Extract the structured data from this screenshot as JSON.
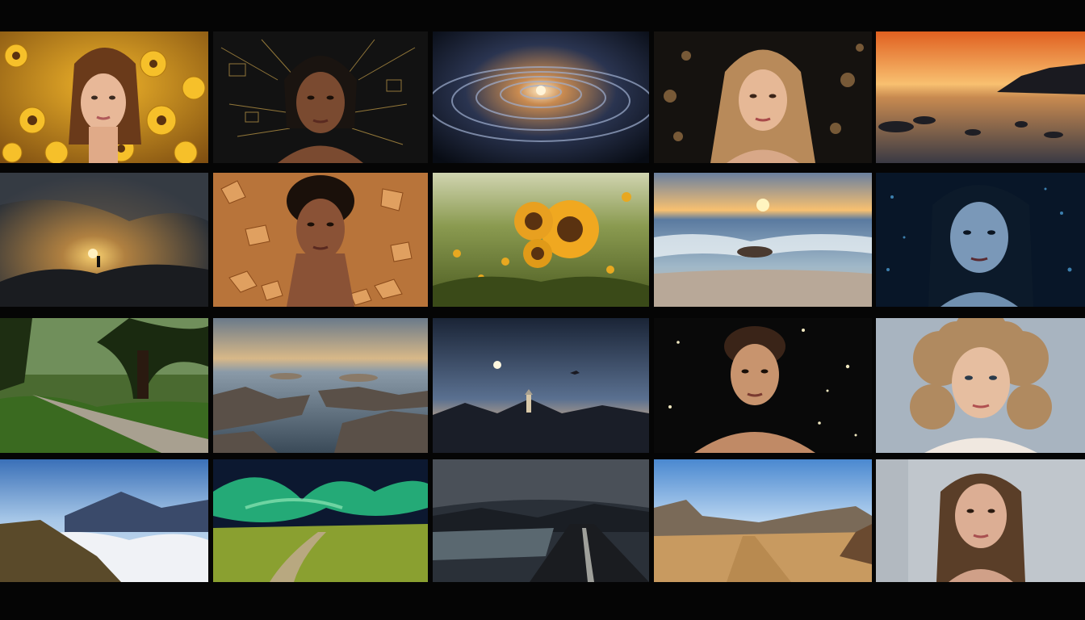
{
  "gallery": {
    "columns": 5,
    "rows": 4,
    "tiles": [
      {
        "subject": "woman-portrait-sunflowers",
        "palette": [
          "#c98a1a",
          "#f0b42a",
          "#3a2a12"
        ]
      },
      {
        "subject": "woman-portrait-golden-lines",
        "palette": [
          "#141414",
          "#c9a24a",
          "#5a3a28"
        ]
      },
      {
        "subject": "cosmic-spiral-vortex",
        "palette": [
          "#0d1420",
          "#f0c890",
          "#3a4a68"
        ]
      },
      {
        "subject": "woman-portrait-bokeh",
        "palette": [
          "#141210",
          "#d8a878",
          "#c6935c"
        ]
      },
      {
        "subject": "sunset-rocky-shore",
        "palette": [
          "#f08a2a",
          "#f8c070",
          "#2a2a30"
        ]
      },
      {
        "subject": "hiker-sunset-mountains",
        "palette": [
          "#3a4048",
          "#e0a040",
          "#1a1c20"
        ]
      },
      {
        "subject": "woman-portrait-autumn-leaves",
        "palette": [
          "#b8743a",
          "#e0a060",
          "#2a1a10"
        ]
      },
      {
        "subject": "sunflower-field",
        "palette": [
          "#6a7a3a",
          "#e0a020",
          "#c8d0a0"
        ]
      },
      {
        "subject": "ocean-wave-sunset",
        "palette": [
          "#f0a050",
          "#5a80a0",
          "#d0c0b0"
        ]
      },
      {
        "subject": "woman-portrait-blue-glow",
        "palette": [
          "#0a1a30",
          "#4a90c0",
          "#a8c0d0"
        ]
      },
      {
        "subject": "forest-path",
        "palette": [
          "#2a4a20",
          "#7aa040",
          "#a8a090"
        ]
      },
      {
        "subject": "rocky-coast-aerial",
        "palette": [
          "#b0a080",
          "#4a5a6a",
          "#7a6a5a"
        ]
      },
      {
        "subject": "lighthouse-night-mountains",
        "palette": [
          "#1a2030",
          "#4a6080",
          "#c8b090"
        ]
      },
      {
        "subject": "woman-portrait-stars",
        "palette": [
          "#0a0a0a",
          "#c89070",
          "#f0e8c0"
        ]
      },
      {
        "subject": "woman-portrait-curly-hair",
        "palette": [
          "#b09070",
          "#e0c0a0",
          "#9aaec0"
        ]
      },
      {
        "subject": "mountains-above-clouds",
        "palette": [
          "#5a88c0",
          "#f0f0f0",
          "#6a5a3a"
        ]
      },
      {
        "subject": "aurora-grassland",
        "palette": [
          "#2ad08a",
          "#8aa030",
          "#101830"
        ]
      },
      {
        "subject": "road-lake-storm",
        "palette": [
          "#2a3038",
          "#5a6870",
          "#1a1c20"
        ]
      },
      {
        "subject": "desert-road-mountains",
        "palette": [
          "#7ab0e0",
          "#c89a60",
          "#8a6a40"
        ]
      },
      {
        "subject": "woman-portrait-soft-light",
        "palette": [
          "#c8ccd0",
          "#d8b09a",
          "#5a4030"
        ]
      }
    ]
  }
}
